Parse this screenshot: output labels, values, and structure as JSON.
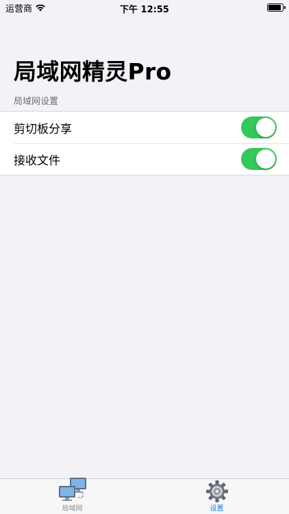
{
  "status_bar": {
    "carrier": "运营商",
    "time": "下午 12:55"
  },
  "title": "局域网精灵Pro",
  "section_header": "局域网设置",
  "settings": [
    {
      "label": "剪切板分享",
      "enabled": true
    },
    {
      "label": "接收文件",
      "enabled": true
    }
  ],
  "tabs": [
    {
      "label": "局域网",
      "icon": "computers-icon",
      "active": false
    },
    {
      "label": "设置",
      "icon": "gear-icon",
      "active": true
    }
  ],
  "colors": {
    "toggle_on": "#34c759",
    "tab_active": "#1a7ae0",
    "background": "#f2f2f7"
  }
}
